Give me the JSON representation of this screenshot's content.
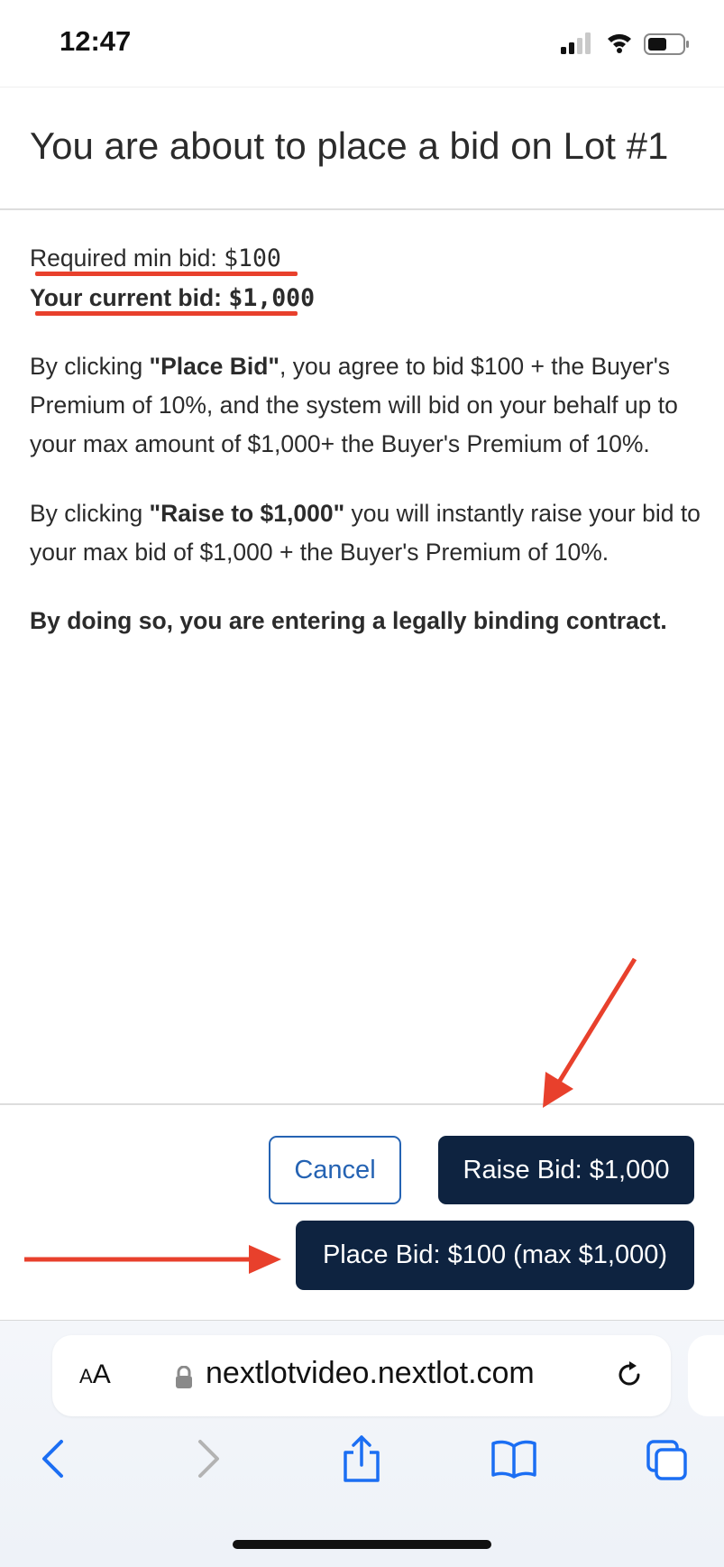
{
  "status_bar": {
    "time": "12:47",
    "icons": [
      "signal-icon",
      "wifi-icon",
      "battery-icon"
    ]
  },
  "modal": {
    "title": "You are about to place a bid on Lot #1",
    "min_bid_label": "Required min bid: ",
    "min_bid_value": "$100",
    "current_bid_label": "Your current bid: ",
    "current_bid_value": "$1,000",
    "para1": {
      "prefix": "By clicking ",
      "bold": "\"Place Bid\"",
      "suffix": ", you agree to bid $100  + the Buyer's Premium of 10%, and the system will bid on your behalf up to your max amount of $1,000+ the Buyer's Premium of 10%."
    },
    "para2": {
      "prefix": "By clicking ",
      "bold": "\"Raise to $1,000\"",
      "suffix": " you will instantly raise your bid to your max bid of $1,000  + the Buyer's Premium of 10%."
    },
    "para3": "By doing so, you are entering a legally binding contract."
  },
  "buttons": {
    "cancel": "Cancel",
    "raise": "Raise Bid: $1,000",
    "place": "Place Bid: $100 (max $1,000)"
  },
  "annotations": {
    "color": "#e8402c"
  },
  "browser": {
    "aa_small": "A",
    "aa_large": "A",
    "url": "nextlotvideo.nextlot.com",
    "nav_icons": [
      "back-icon",
      "forward-icon",
      "share-icon",
      "bookmarks-icon",
      "tabs-icon"
    ]
  },
  "colors": {
    "primary_button": "#0e2340",
    "cancel_border": "#2563b3",
    "text": "#2b2b2b"
  }
}
